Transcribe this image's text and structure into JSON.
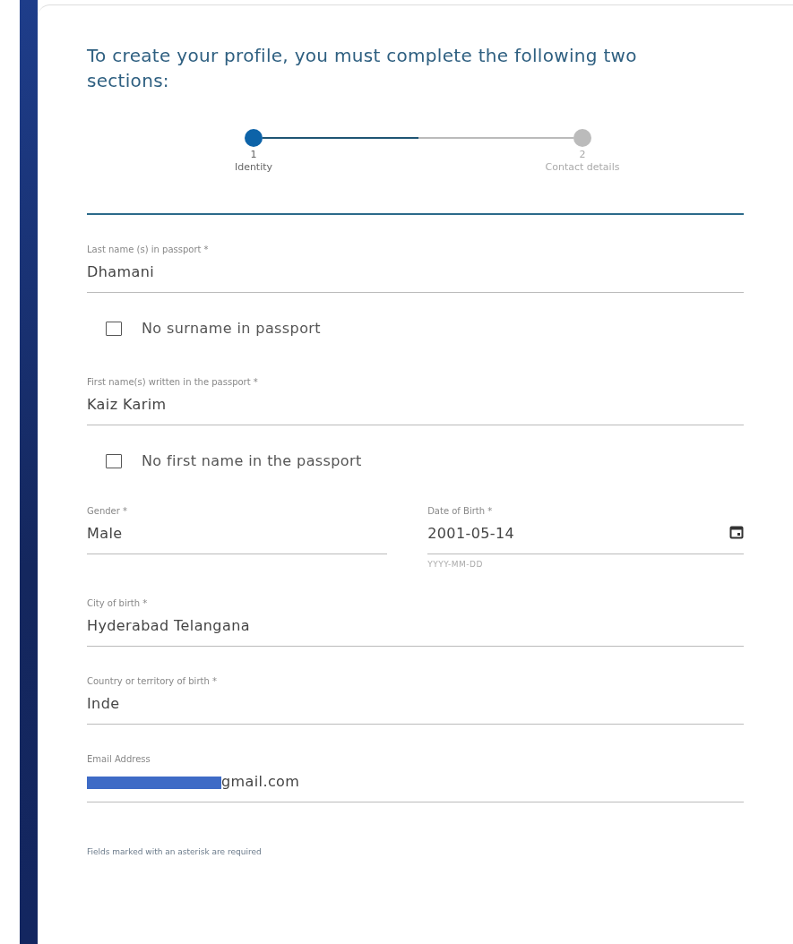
{
  "intro": "To create your profile, you must complete the following two sections:",
  "progress": {
    "level": 0.5
  },
  "steps": [
    {
      "number": "1",
      "label": "Identity",
      "selected": true
    },
    {
      "number": "2",
      "label": "Contact details",
      "selected": false
    }
  ],
  "fields": [
    {
      "kind": "text",
      "label": "Last name (s) in passport *",
      "value": "Dhamani"
    },
    {
      "kind": "checkbox",
      "label": "No surname in passport",
      "checked": false
    },
    {
      "kind": "text",
      "label": "First name(s) written in the passport *",
      "value": "Kaiz Karim"
    },
    {
      "kind": "checkbox",
      "label": "No first name in the passport",
      "checked": false
    },
    {
      "kind": "pair",
      "items": [
        {
          "kind": "text",
          "label": "Gender *",
          "value": "Male"
        },
        {
          "kind": "date",
          "label": "Date of Birth *",
          "value": "2001-05-14",
          "hint": "YYYY-MM-DD"
        }
      ]
    },
    {
      "kind": "text",
      "label": "City of birth *",
      "value": "Hyderabad Telangana"
    },
    {
      "kind": "text",
      "label": "Country or territory of birth *",
      "value": "Inde"
    },
    {
      "kind": "redacted",
      "label": "Email Address",
      "value": "gmail.com"
    }
  ],
  "footnote": "Fields marked with an asterisk are required"
}
